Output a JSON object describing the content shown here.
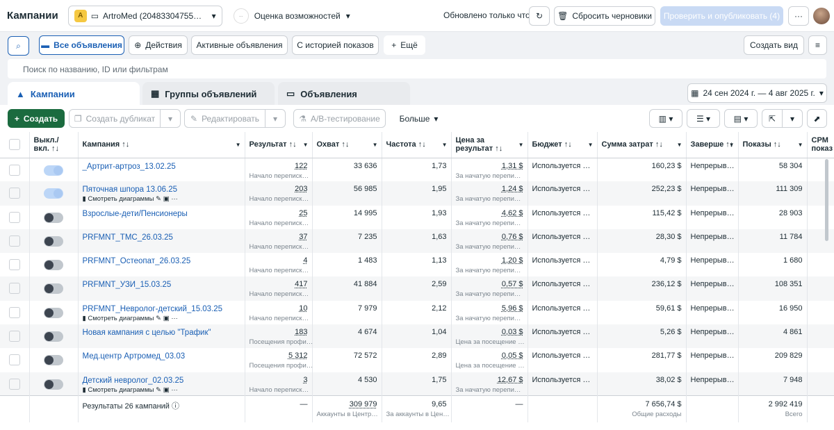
{
  "header": {
    "title": "Кампании",
    "account_badge": "A",
    "account_name": "ArtroMed (20483304755…",
    "eval_label": "Оценка возможностей",
    "updated": "Обновлено только что",
    "discard": "Сбросить черновики",
    "publish": "Проверить и опубликовать (4)",
    "more": "···"
  },
  "toolbar": {
    "all_ads": "Все объявления",
    "actions": "Действия",
    "active": "Активные объявления",
    "history": "С историей показов",
    "more": "Ещё",
    "create_view": "Создать вид"
  },
  "search": {
    "placeholder": "Поиск по названию, ID или фильтрам"
  },
  "tabs": {
    "campaigns": "Кампании",
    "adsets": "Группы объявлений",
    "ads": "Объявления",
    "date_range": "24 сен 2024 г. — 4 авг 2025 г."
  },
  "actions": {
    "create": "Создать",
    "duplicate": "Создать дубликат",
    "edit": "Редактировать",
    "ab": "A/B-тестирование",
    "more": "Больше"
  },
  "columns": [
    "Выкл./ вкл. ↑↓",
    "Кампания ↑↓",
    "Результат ↑↓",
    "Охват ↑↓",
    "Частота ↑↓",
    "Цена за результат ↑↓",
    "Бюджет ↑↓",
    "Сумма затрат ↑↓",
    "Заверше ↑↓",
    "Показы ↑↓",
    "CPM показ"
  ],
  "rows": [
    {
      "on": true,
      "name": "_Артрит-артроз_13.02.25",
      "charts": "",
      "result": "122",
      "result_sub": "Начало переписк…",
      "reach": "33 636",
      "freq": "1,73",
      "cpr": "1,31 $",
      "cpr_sub": "За начатую перепи…",
      "budget": "Используется …",
      "spent": "160,23 $",
      "end": "Непрерыв…",
      "impr": "58 304"
    },
    {
      "on": true,
      "name": "Пяточная шпора 13.06.25",
      "charts": "Смотреть диаграммы",
      "result": "203",
      "result_sub": "Начало переписк…",
      "reach": "56 985",
      "freq": "1,95",
      "cpr": "1,24 $",
      "cpr_sub": "За начатую перепи…",
      "budget": "Используется …",
      "spent": "252,23 $",
      "end": "Непрерыв…",
      "impr": "111 309"
    },
    {
      "on": false,
      "name": "Взрослые-дети/Пенсионеры",
      "charts": "",
      "result": "25",
      "result_sub": "Начало переписк…",
      "reach": "14 995",
      "freq": "1,93",
      "cpr": "4,62 $",
      "cpr_sub": "За начатую перепи…",
      "budget": "Используется …",
      "spent": "115,42 $",
      "end": "Непрерыв…",
      "impr": "28 903"
    },
    {
      "on": false,
      "name": "PRFMNT_ТМС_26.03.25",
      "charts": "",
      "result": "37",
      "result_sub": "Начало переписк…",
      "reach": "7 235",
      "freq": "1,63",
      "cpr": "0,76 $",
      "cpr_sub": "За начатую перепи…",
      "budget": "Используется …",
      "spent": "28,30 $",
      "end": "Непрерыв…",
      "impr": "11 784"
    },
    {
      "on": false,
      "name": "PRFMNT_Остеопат_26.03.25",
      "charts": "",
      "result": "4",
      "result_sub": "Начало переписк…",
      "reach": "1 483",
      "freq": "1,13",
      "cpr": "1,20 $",
      "cpr_sub": "За начатую перепи…",
      "budget": "Используется …",
      "spent": "4,79 $",
      "end": "Непрерыв…",
      "impr": "1 680"
    },
    {
      "on": false,
      "name": "PRFMNT_УЗИ_15.03.25",
      "charts": "",
      "result": "417",
      "result_sub": "Начало переписк…",
      "reach": "41 884",
      "freq": "2,59",
      "cpr": "0,57 $",
      "cpr_sub": "За начатую перепи…",
      "budget": "Используется …",
      "spent": "236,12 $",
      "end": "Непрерыв…",
      "impr": "108 351"
    },
    {
      "on": false,
      "name": "PRFMNT_Невролог-детский_15.03.25",
      "charts": "Смотреть диаграммы",
      "result": "10",
      "result_sub": "Начало переписк…",
      "reach": "7 979",
      "freq": "2,12",
      "cpr": "5,96 $",
      "cpr_sub": "За начатую перепи…",
      "budget": "Используется …",
      "spent": "59,61 $",
      "end": "Непрерыв…",
      "impr": "16 950"
    },
    {
      "on": false,
      "name": "Новая кампания с целью \"Трафик\"",
      "charts": "",
      "result": "183",
      "result_sub": "Посещения профи…",
      "reach": "4 674",
      "freq": "1,04",
      "cpr": "0,03 $",
      "cpr_sub": "Цена за посещение …",
      "budget": "Используется …",
      "spent": "5,26 $",
      "end": "Непрерыв…",
      "impr": "4 861"
    },
    {
      "on": false,
      "name": "Мед.центр Артромед_03.03",
      "charts": "",
      "result": "5 312",
      "result_sub": "Посещения профи…",
      "reach": "72 572",
      "freq": "2,89",
      "cpr": "0,05 $",
      "cpr_sub": "Цена за посещение …",
      "budget": "Используется …",
      "spent": "281,77 $",
      "end": "Непрерыв…",
      "impr": "209 829"
    },
    {
      "on": false,
      "name": "Детский невролог_02.03.25",
      "charts": "Смотреть диаграммы",
      "result": "3",
      "result_sub": "Начало переписк…",
      "reach": "4 530",
      "freq": "1,75",
      "cpr": "12,67 $",
      "cpr_sub": "За начатую перепи…",
      "budget": "Используется …",
      "spent": "38,02 $",
      "end": "Непрерыв…",
      "impr": "7 948"
    }
  ],
  "footer": {
    "label": "Результаты 26 кампаний",
    "result": "—",
    "reach": "309 979",
    "reach_sub": "Аккаунты в Центр…",
    "freq": "9,65",
    "freq_sub": "За аккаунты в Цен…",
    "cpr": "—",
    "spent": "7 656,74 $",
    "spent_sub": "Общие расходы",
    "impr": "2 992 419",
    "impr_sub": "Всего"
  }
}
